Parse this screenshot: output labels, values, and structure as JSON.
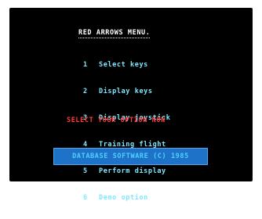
{
  "menu_title": "RED ARROWS MENU.",
  "options": [
    {
      "number": "1",
      "label": "Select keys"
    },
    {
      "number": "2",
      "label": "Display keys"
    },
    {
      "number": "3",
      "label": "Display joystick"
    },
    {
      "number": "4",
      "label": "Training flight"
    },
    {
      "number": "5",
      "label": "Perform display"
    },
    {
      "number": "6",
      "label": "Demo option"
    }
  ],
  "prompt": "SELECT YOUR OPTION NOW",
  "banner": "DATABASE SOFTWARE (C) 1985",
  "colors": {
    "screen": "#000000",
    "title": "#ffffff",
    "menu_text": "#7fe8ff",
    "prompt": "#ff3a3a",
    "banner_bg": "#1e73c8",
    "banner_text": "#4fd0ff"
  }
}
